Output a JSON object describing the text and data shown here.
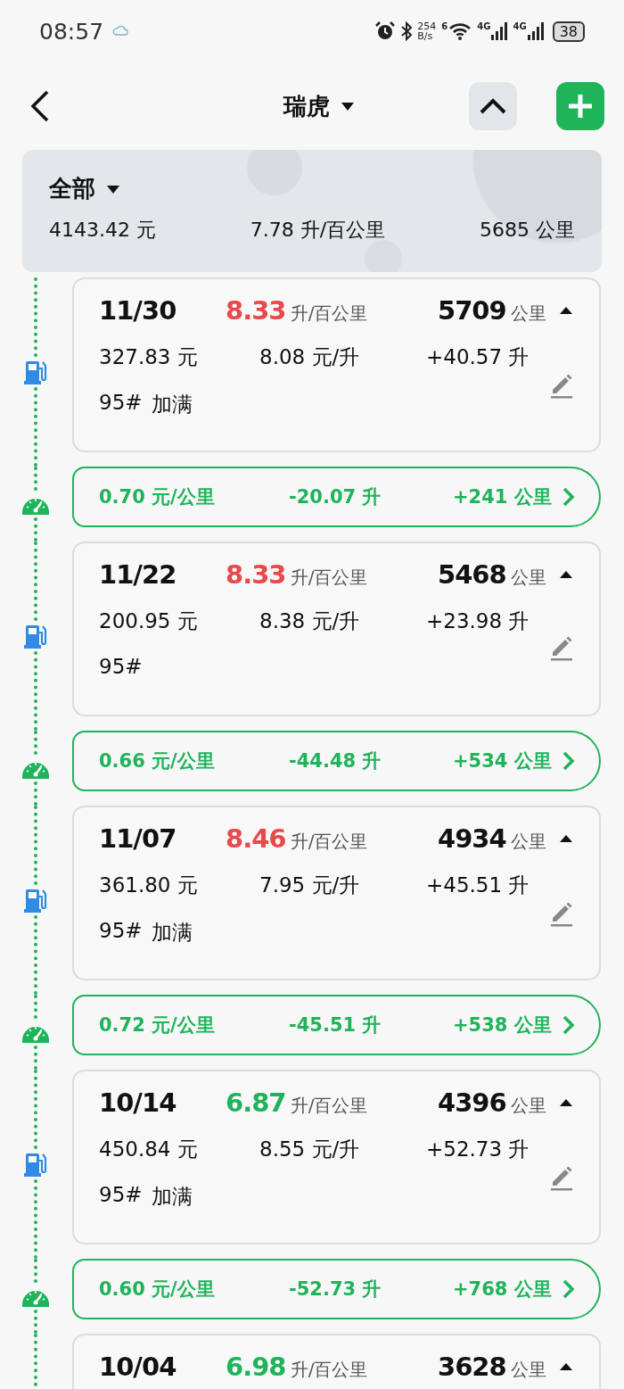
{
  "status_bar": {
    "time": "08:57",
    "net_speed": [
      "254",
      "B/s"
    ],
    "wifi_label": "6",
    "sim_labels": [
      "4G",
      "4G"
    ],
    "battery": "38"
  },
  "header": {
    "title": "瑞虎"
  },
  "summary": {
    "filter": "全部",
    "cost": "4143.42 元",
    "consumption": "7.78 升/百公里",
    "distance": "5685 公里"
  },
  "entries": [
    {
      "kind": "refuel",
      "date": "11/30",
      "consumption": "8.33",
      "consumption_unit": "升/百公里",
      "color": "#e8494a",
      "odometer": "5709",
      "odometer_unit": "公里",
      "cost": "327.83 元",
      "unit_price": "8.08 元/升",
      "volume": "+40.57 升",
      "fuel": "95#",
      "full": "加满"
    },
    {
      "kind": "segment",
      "cost_per_km": "0.70 元/公里",
      "fuel_delta": "-20.07 升",
      "distance": "+241 公里"
    },
    {
      "kind": "refuel",
      "date": "11/22",
      "consumption": "8.33",
      "consumption_unit": "升/百公里",
      "color": "#e8494a",
      "odometer": "5468",
      "odometer_unit": "公里",
      "cost": "200.95 元",
      "unit_price": "8.38 元/升",
      "volume": "+23.98 升",
      "fuel": "95#"
    },
    {
      "kind": "segment",
      "cost_per_km": "0.66 元/公里",
      "fuel_delta": "-44.48 升",
      "distance": "+534 公里"
    },
    {
      "kind": "refuel",
      "date": "11/07",
      "consumption": "8.46",
      "consumption_unit": "升/百公里",
      "color": "#e8494a",
      "odometer": "4934",
      "odometer_unit": "公里",
      "cost": "361.80 元",
      "unit_price": "7.95 元/升",
      "volume": "+45.51 升",
      "fuel": "95#",
      "full": "加满"
    },
    {
      "kind": "segment",
      "cost_per_km": "0.72 元/公里",
      "fuel_delta": "-45.51 升",
      "distance": "+538 公里"
    },
    {
      "kind": "refuel",
      "date": "10/14",
      "consumption": "6.87",
      "consumption_unit": "升/百公里",
      "color": "#1fb35a",
      "odometer": "4396",
      "odometer_unit": "公里",
      "cost": "450.84 元",
      "unit_price": "8.55 元/升",
      "volume": "+52.73 升",
      "fuel": "95#",
      "full": "加满"
    },
    {
      "kind": "segment",
      "cost_per_km": "0.60 元/公里",
      "fuel_delta": "-52.73 升",
      "distance": "+768 公里"
    },
    {
      "kind": "refuel",
      "date": "10/04",
      "consumption": "6.98",
      "consumption_unit": "升/百公里",
      "color": "#1fb35a",
      "odometer": "3628",
      "odometer_unit": "公里"
    }
  ]
}
